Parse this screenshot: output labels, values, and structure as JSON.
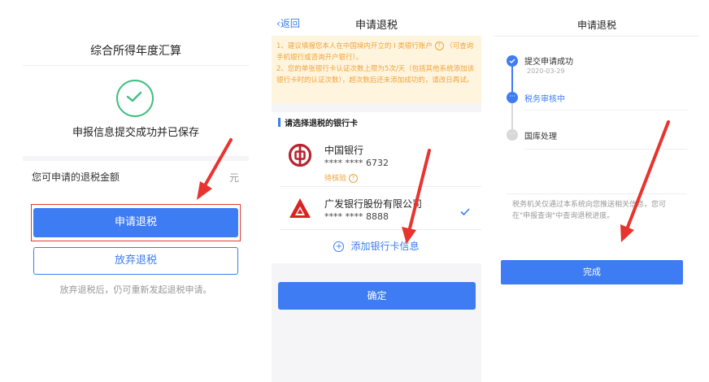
{
  "panel1": {
    "title": "综合所得年度汇算",
    "success_text": "申报信息提交成功并已保存",
    "amount_label": "您可申请的退税金额",
    "amount_unit": "元",
    "apply_button": "申请退税",
    "giveup_button": "放弃退税",
    "note": "放弃退税后，仍可重新发起退税申请。",
    "check_icon": "check-circle-icon",
    "colors": {
      "success": "#3fbf7f",
      "primary": "#3d7cf2",
      "highlight": "#e53935"
    }
  },
  "panel2": {
    "back_label": "返回",
    "title": "申请退税",
    "notice_line1a": "1、建议填报您本人在中国境内开立的 I 类银行账户",
    "notice_q": "?",
    "notice_line1b": "（可查询手机银行或咨询开户银行）。",
    "notice_line2": "2、您的单张银行卡认证次数上限为5次/天（包括其他系统添加该银行卡时的认证次数），超次数后还未添加成功的，请改日再试。",
    "section_title": "请选择退税的银行卡",
    "cards": [
      {
        "bank": "中国银行",
        "number": "**** **** 6732",
        "status": "待核验",
        "icon": "boc-logo-icon"
      },
      {
        "bank": "广发银行股份有限公司",
        "number": "**** **** 8888",
        "icon": "cgb-logo-icon",
        "selected": true
      }
    ],
    "add_card": "添加银行卡信息",
    "confirm_button": "确定",
    "colors": {
      "notice_bg": "#fff5df",
      "notice_text": "#f0a23a",
      "primary": "#3d7cf2",
      "boc": "#b8232f",
      "cgb": "#d72421"
    }
  },
  "panel3": {
    "title": "申请退税",
    "steps": [
      {
        "label": "提交申请成功",
        "date": "2020-03-29",
        "state": "done"
      },
      {
        "label": "税务审核中",
        "state": "active"
      },
      {
        "label": "国库处理",
        "state": "pending"
      }
    ],
    "info": "税务机关仅通过本系统向您推送相关信息，您可在\"申报查询\"中查询退税进度。",
    "done_button": "完成",
    "colors": {
      "primary": "#3d7cf2",
      "pending": "#d8d8d8"
    }
  },
  "annotation_arrow_color": "#e8332e"
}
